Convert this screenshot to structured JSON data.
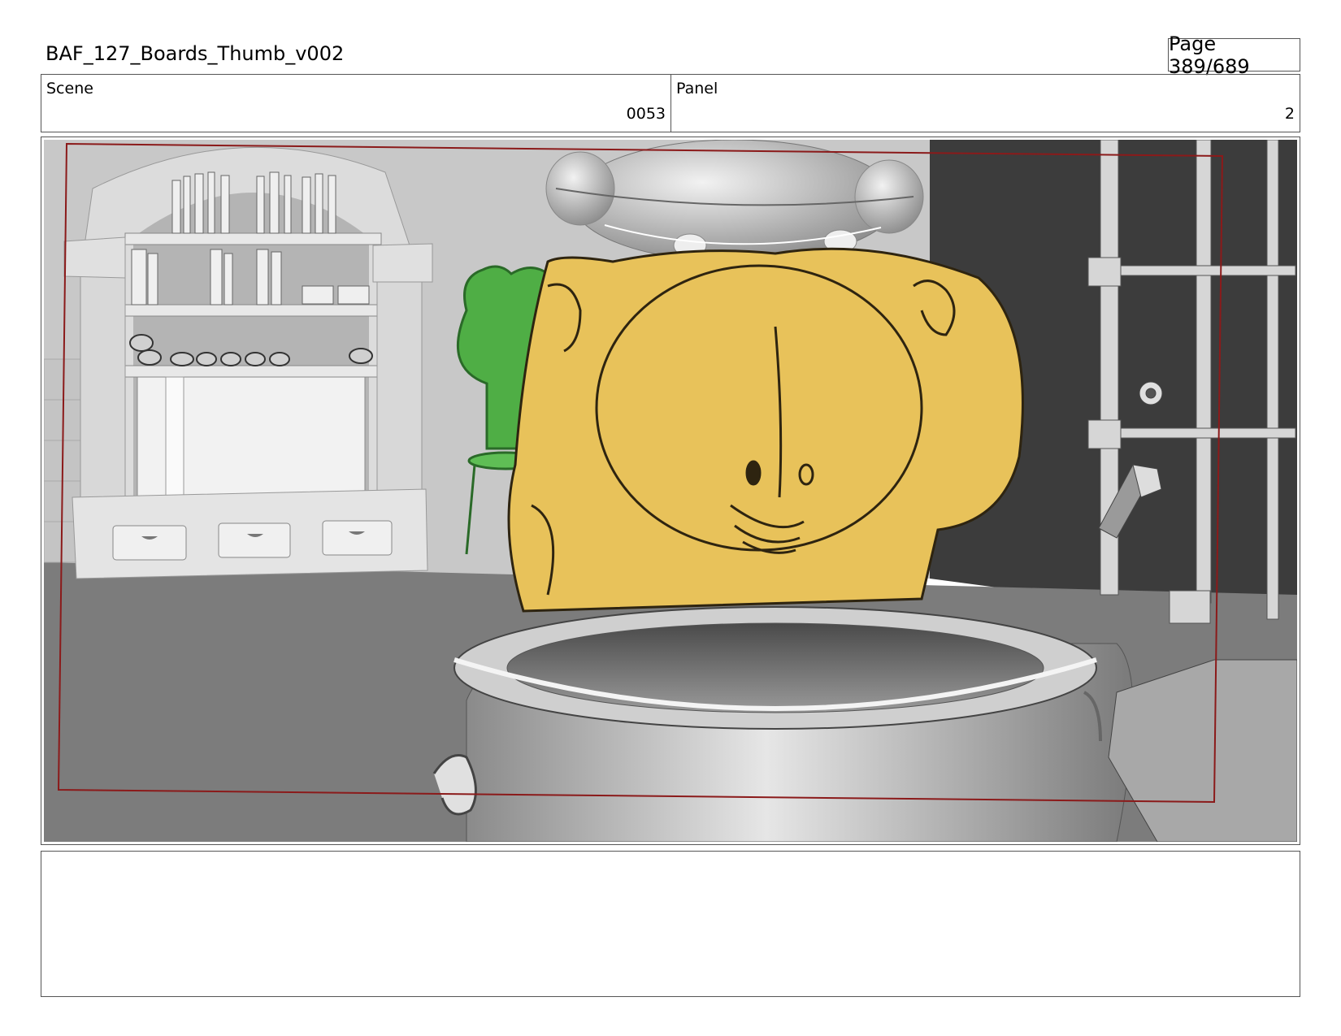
{
  "header": {
    "title": "BAF_127_Boards_Thumb_v002",
    "page": "Page 389/689"
  },
  "scene": {
    "label": "Scene",
    "value": "0053"
  },
  "panel": {
    "label": "Panel",
    "value": "2"
  },
  "frame": {
    "description_icon": "storyboard-frame",
    "colors": {
      "safe_area": "#8b1a1a",
      "character_yellow": "#e8c25a",
      "character_green": "#4fae45",
      "floor": "#7a7a7a",
      "wall_dark": "#3a3a3a"
    }
  },
  "notes": {
    "text": ""
  }
}
